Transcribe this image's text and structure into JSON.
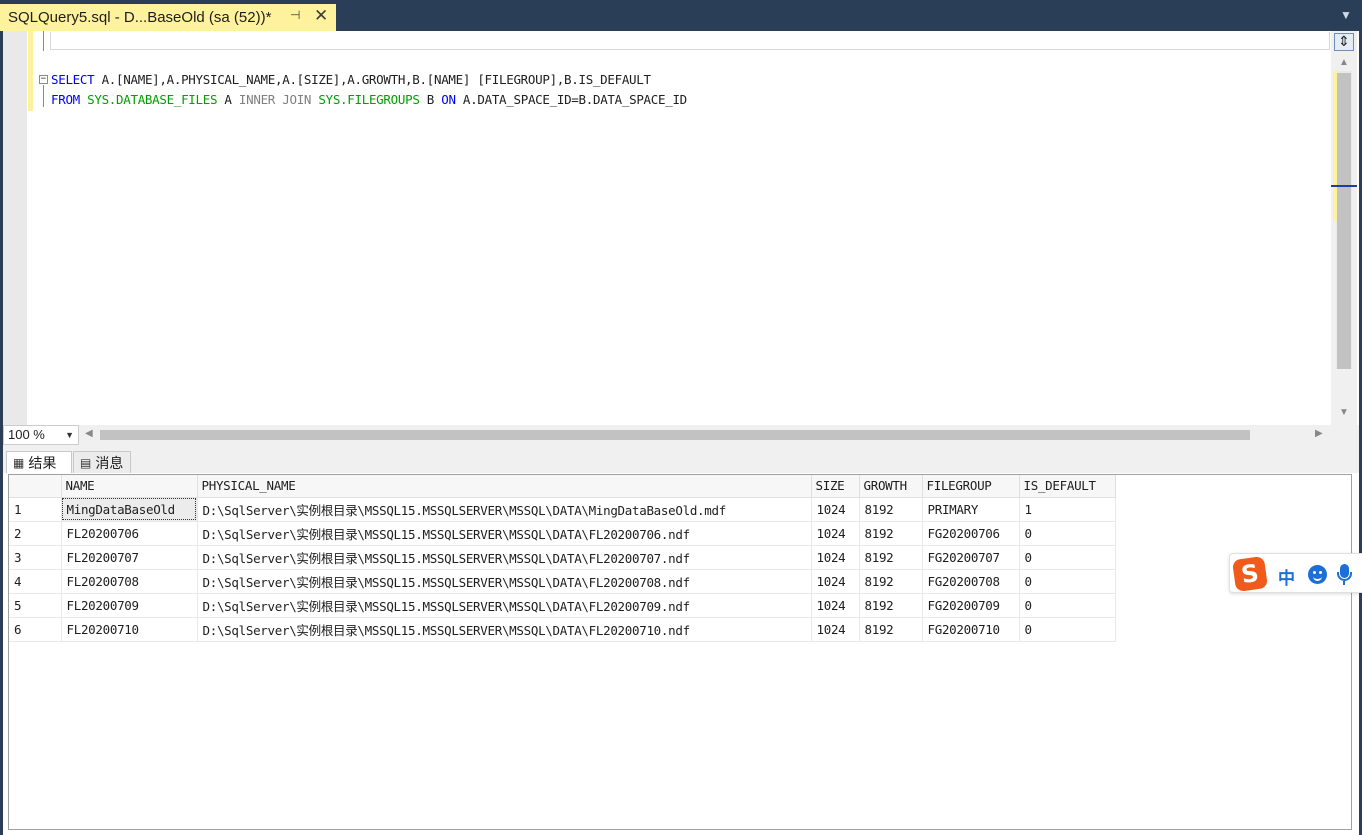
{
  "tab": {
    "title": "SQLQuery5.sql - D...BaseOld (sa (52))*",
    "pin_icon": "pin-icon",
    "close_icon": "close-icon"
  },
  "editor": {
    "line1": {
      "select": "SELECT",
      "cols": " A.[NAME],A.PHYSICAL_NAME,A.[SIZE],A.GROWTH,B.[NAME] [FILEGROUP],B.IS_DEFAULT"
    },
    "line2": {
      "from": "FROM",
      "t1": " SYS.DATABASE_FILES",
      "a": " A ",
      "join": "INNER JOIN",
      "t2": " SYS.FILEGROUPS",
      "b": " B ",
      "on": "ON",
      "cond": " A.DATA_SPACE_ID=B.DATA_SPACE_ID"
    },
    "fold_glyph": "−"
  },
  "zoom": {
    "value": "100 %"
  },
  "results_tabs": {
    "results": "结果",
    "messages": "消息"
  },
  "grid": {
    "columns": [
      "NAME",
      "PHYSICAL_NAME",
      "SIZE",
      "GROWTH",
      "FILEGROUP",
      "IS_DEFAULT"
    ],
    "rows": [
      [
        "1",
        "MingDataBaseOld",
        "D:\\SqlServer\\实例根目录\\MSSQL15.MSSQLSERVER\\MSSQL\\DATA\\MingDataBaseOld.mdf",
        "1024",
        "8192",
        "PRIMARY",
        "1"
      ],
      [
        "2",
        "FL20200706",
        "D:\\SqlServer\\实例根目录\\MSSQL15.MSSQLSERVER\\MSSQL\\DATA\\FL20200706.ndf",
        "1024",
        "8192",
        "FG20200706",
        "0"
      ],
      [
        "3",
        "FL20200707",
        "D:\\SqlServer\\实例根目录\\MSSQL15.MSSQLSERVER\\MSSQL\\DATA\\FL20200707.ndf",
        "1024",
        "8192",
        "FG20200707",
        "0"
      ],
      [
        "4",
        "FL20200708",
        "D:\\SqlServer\\实例根目录\\MSSQL15.MSSQLSERVER\\MSSQL\\DATA\\FL20200708.ndf",
        "1024",
        "8192",
        "FG20200708",
        "0"
      ],
      [
        "5",
        "FL20200709",
        "D:\\SqlServer\\实例根目录\\MSSQL15.MSSQLSERVER\\MSSQL\\DATA\\FL20200709.ndf",
        "1024",
        "8192",
        "FG20200709",
        "0"
      ],
      [
        "6",
        "FL20200710",
        "D:\\SqlServer\\实例根目录\\MSSQL15.MSSQLSERVER\\MSSQL\\DATA\\FL20200710.ndf",
        "1024",
        "8192",
        "FG20200710",
        "0"
      ]
    ]
  },
  "ime": {
    "logo": "S",
    "mode": "中"
  },
  "colors": {
    "tab_active": "#fff29d",
    "chrome": "#2b3e58",
    "keyword": "#0000ff",
    "system_object": "#00a000"
  }
}
